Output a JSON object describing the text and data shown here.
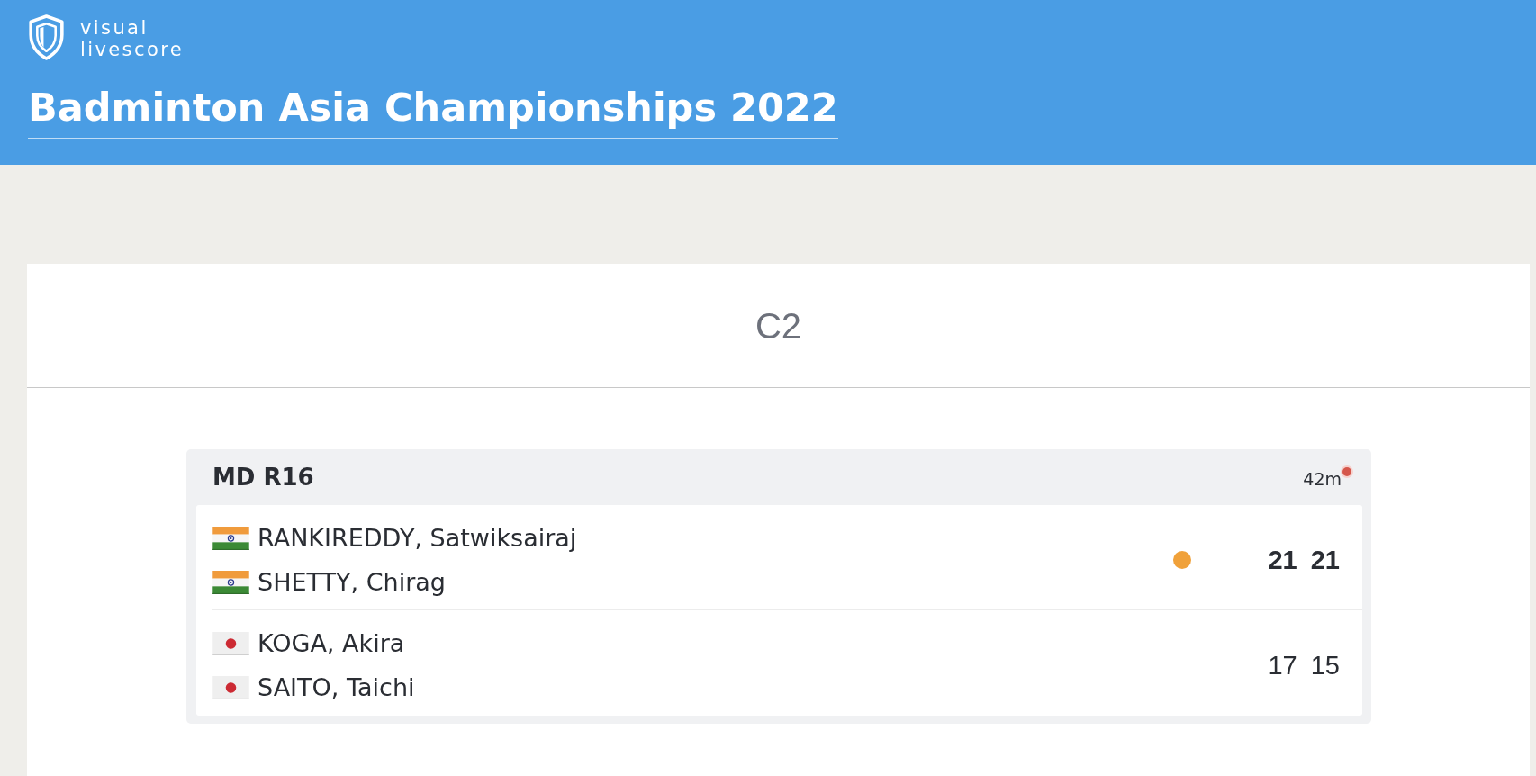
{
  "header": {
    "logo_text": "visual livescore",
    "title": "Badminton Asia Championships 2022"
  },
  "court": {
    "name": "C2"
  },
  "matches": [
    {
      "event": "MD R16",
      "duration": "42m",
      "live": true,
      "teams": [
        {
          "players": [
            {
              "name": "RANKIREDDY, Satwiksairaj",
              "kind": "india"
            },
            {
              "name": "SHETTY, Chirag",
              "kind": "india"
            }
          ],
          "serving": true,
          "winner": true,
          "scores": [
            "21",
            "21"
          ]
        },
        {
          "players": [
            {
              "name": "KOGA, Akira",
              "kind": "japan"
            },
            {
              "name": "SAITO, Taichi",
              "kind": "japan"
            }
          ],
          "serving": false,
          "winner": false,
          "scores": [
            "17",
            "15"
          ]
        }
      ]
    }
  ]
}
